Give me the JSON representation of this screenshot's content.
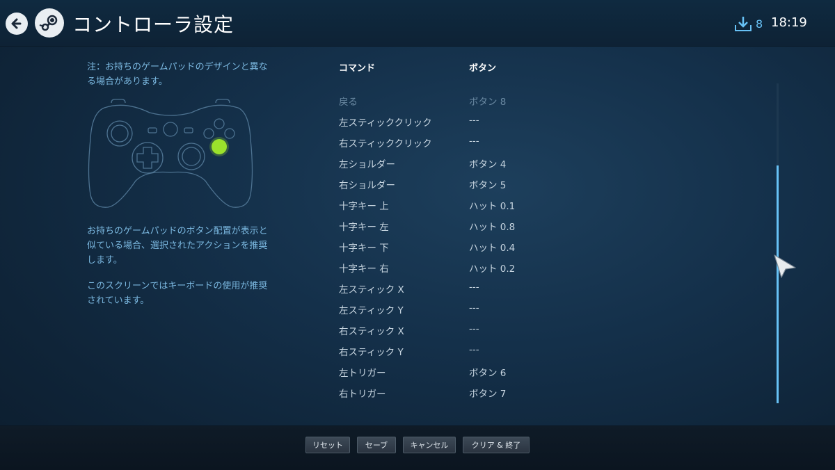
{
  "header": {
    "title": "コントローラ設定",
    "download_count": "8",
    "clock": "18:19"
  },
  "left_panel": {
    "note": "注：お持ちのゲームパッドのデザインと異なる場合があります。",
    "description1": "お持ちのゲームパッドのボタン配置が表示と似ている場合、選択されたアクションを推奨します。",
    "description2": "このスクリーンではキーボードの使用が推奨されています。"
  },
  "table": {
    "col_command": "コマンド",
    "col_button": "ボタン",
    "rows": [
      {
        "command": "戻る",
        "button": "ボタン 8"
      },
      {
        "command": "左スティッククリック",
        "button": "---"
      },
      {
        "command": "右スティッククリック",
        "button": "---"
      },
      {
        "command": "左ショルダー",
        "button": "ボタン 4"
      },
      {
        "command": "右ショルダー",
        "button": "ボタン 5"
      },
      {
        "command": "十字キー 上",
        "button": "ハット 0.1"
      },
      {
        "command": "十字キー 左",
        "button": "ハット 0.8"
      },
      {
        "command": "十字キー 下",
        "button": "ハット 0.4"
      },
      {
        "command": "十字キー 右",
        "button": "ハット 0.2"
      },
      {
        "command": "左スティック X",
        "button": "---"
      },
      {
        "command": "左スティック Y",
        "button": "---"
      },
      {
        "command": "右スティック X",
        "button": "---"
      },
      {
        "command": "右スティック Y",
        "button": "---"
      },
      {
        "command": "左トリガー",
        "button": "ボタン 6"
      },
      {
        "command": "右トリガー",
        "button": "ボタン 7"
      }
    ]
  },
  "footer": {
    "reset": "リセット",
    "save": "セーブ",
    "cancel": "キャンセル",
    "clear_exit": "クリア & 終了"
  },
  "icons": {
    "back": "back-arrow-icon",
    "logo": "steam-logo-icon",
    "download": "download-icon",
    "gamepad": "gamepad-diagram",
    "cursor": "mouse-cursor-icon"
  },
  "colors": {
    "accent": "#67c1f5",
    "highlight_button": "#9be22d",
    "background": "#14304a"
  }
}
